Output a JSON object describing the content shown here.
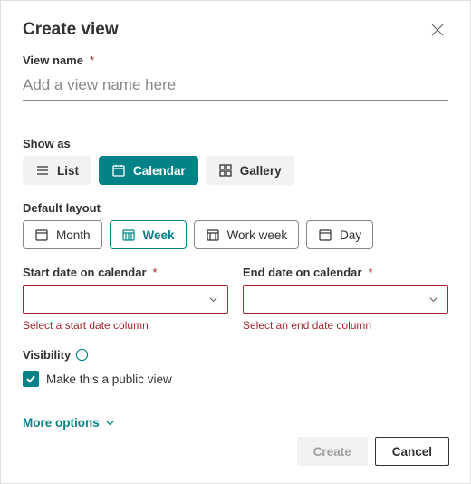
{
  "dialog": {
    "title": "Create view"
  },
  "viewName": {
    "label": "View name",
    "placeholder": "Add a view name here",
    "value": ""
  },
  "showAs": {
    "label": "Show as",
    "options": {
      "list": "List",
      "calendar": "Calendar",
      "gallery": "Gallery"
    },
    "selected": "calendar"
  },
  "defaultLayout": {
    "label": "Default layout",
    "options": {
      "month": "Month",
      "week": "Week",
      "workweek": "Work week",
      "day": "Day"
    },
    "selected": "week"
  },
  "startDate": {
    "label": "Start date on calendar",
    "value": "",
    "error": "Select a start date column"
  },
  "endDate": {
    "label": "End date on calendar",
    "value": "",
    "error": "Select an end date column"
  },
  "visibility": {
    "label": "Visibility",
    "checkboxLabel": "Make this a public view",
    "checked": true
  },
  "moreOptions": "More options",
  "footer": {
    "create": "Create",
    "cancel": "Cancel"
  }
}
